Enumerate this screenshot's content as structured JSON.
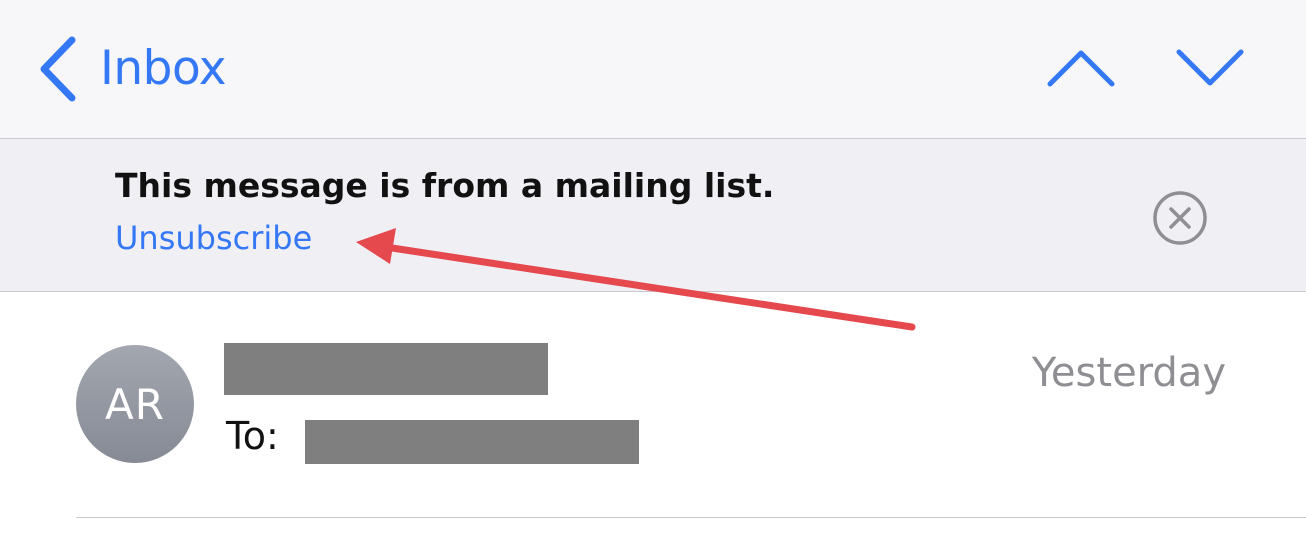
{
  "nav": {
    "back_label": "Inbox",
    "back_icon": "chevron-left-icon",
    "prev_icon": "chevron-up-icon",
    "next_icon": "chevron-down-icon"
  },
  "banner": {
    "title": "This message is from a mailing list.",
    "link": "Unsubscribe",
    "dismiss_icon": "circle-x-icon"
  },
  "message": {
    "avatar_initials": "AR",
    "to_label": "To:",
    "date": "Yesterday"
  },
  "colors": {
    "accent": "#3478f6",
    "annotation": "#e5484d",
    "redaction": "#7f7f7f"
  }
}
